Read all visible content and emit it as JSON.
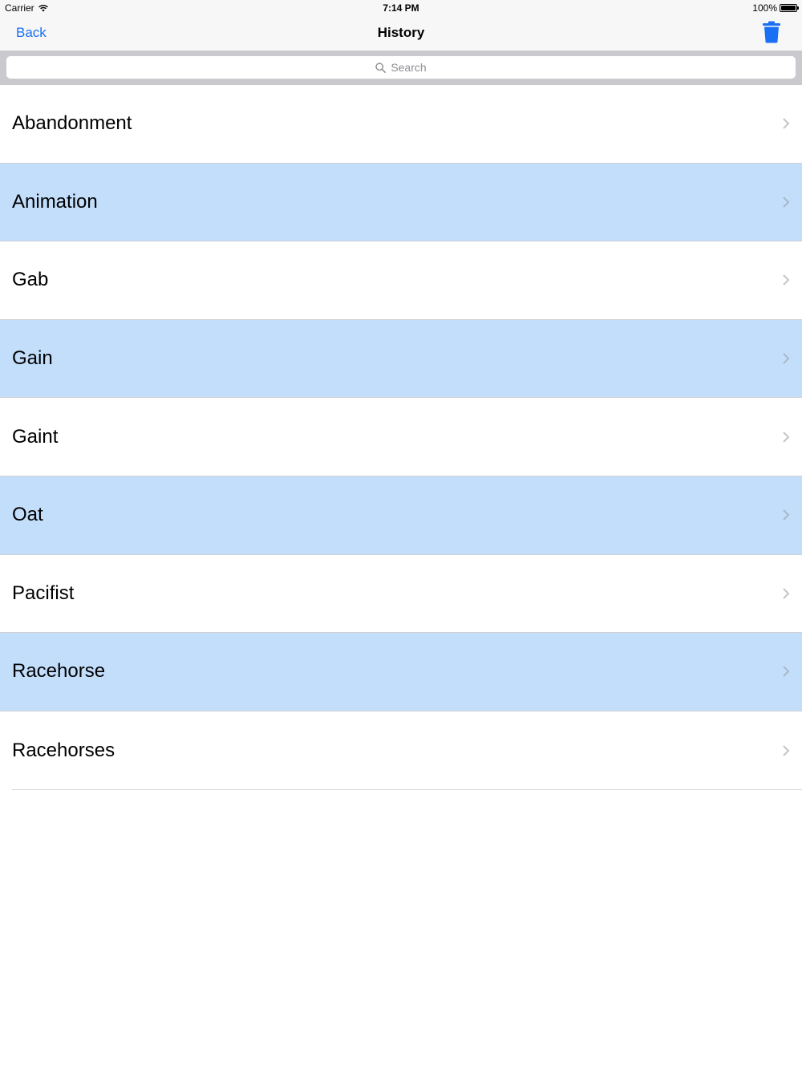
{
  "status": {
    "carrier": "Carrier",
    "time": "7:14 PM",
    "battery_level": "100%",
    "battery_fraction": 1.0
  },
  "nav": {
    "back_label": "Back",
    "title": "History",
    "trash_icon": "trash-icon"
  },
  "search": {
    "placeholder": "Search"
  },
  "history": {
    "items": [
      {
        "label": "Abandonment"
      },
      {
        "label": "Animation"
      },
      {
        "label": "Gab"
      },
      {
        "label": "Gain"
      },
      {
        "label": "Gaint"
      },
      {
        "label": "Oat"
      },
      {
        "label": "Pacifist"
      },
      {
        "label": "Racehorse"
      },
      {
        "label": "Racehorses"
      }
    ]
  },
  "colors": {
    "accent": "#1a6ff5",
    "row_highlight": "#c2defb",
    "search_bar_bg": "#c9c9ce"
  }
}
